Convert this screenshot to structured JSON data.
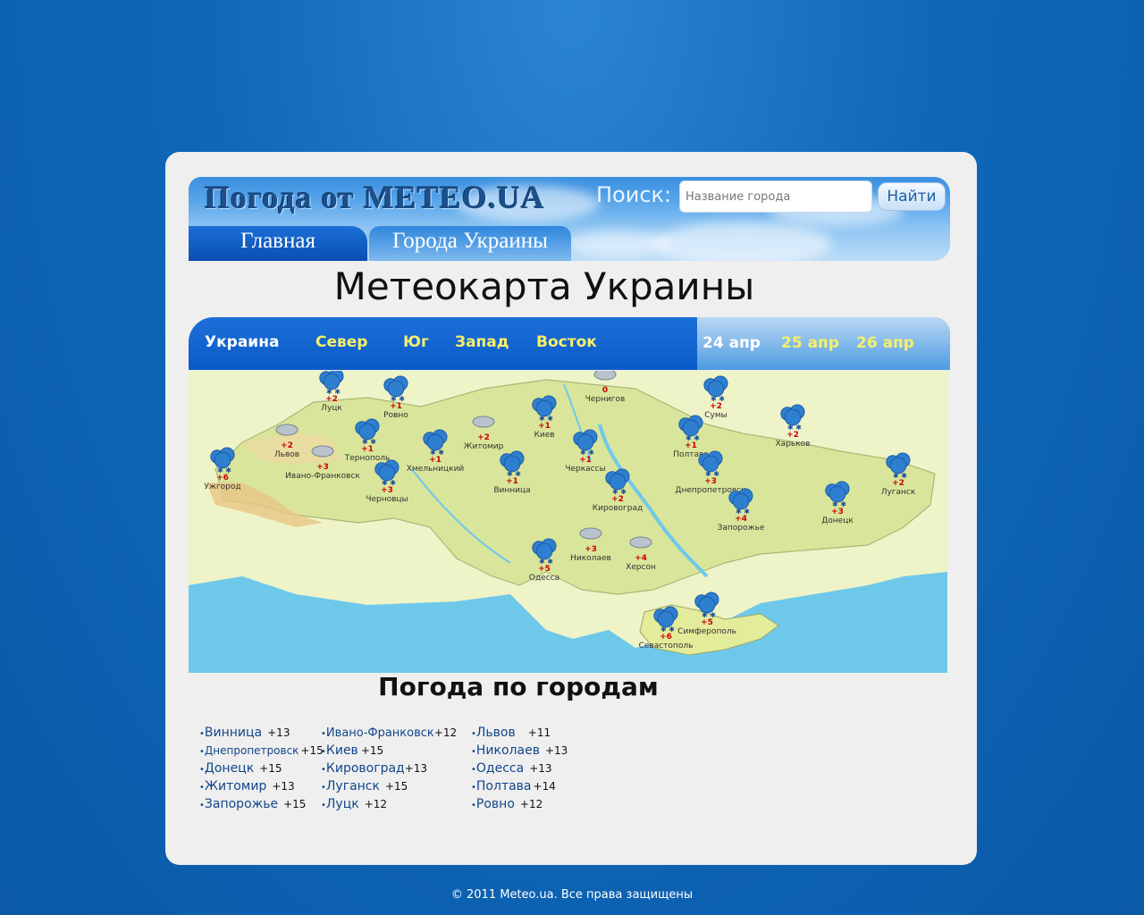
{
  "header": {
    "site_title": "Погода от METEO.UA",
    "search_label": "Поиск:",
    "search_placeholder": "Название города",
    "search_button": "Найти",
    "tabs": [
      {
        "label": "Главная"
      },
      {
        "label": "Города Украины"
      }
    ]
  },
  "page_title": "Метеокарта Украины",
  "region_tabs": [
    {
      "label": "Украина",
      "active": true
    },
    {
      "label": "Север"
    },
    {
      "label": "Юг"
    },
    {
      "label": "Запад"
    },
    {
      "label": "Восток"
    }
  ],
  "date_tabs": [
    {
      "label": "24 апр",
      "active": true
    },
    {
      "label": "25 апр"
    },
    {
      "label": "26 апр"
    }
  ],
  "map": {
    "cities": [
      {
        "name": "Чернигов",
        "temp": "0",
        "icon": "cloud-icon"
      },
      {
        "name": "Луцк",
        "temp": "+2",
        "icon": "rain-snow-icon"
      },
      {
        "name": "Ровно",
        "temp": "+1",
        "icon": "rain-snow-icon"
      },
      {
        "name": "Сумы",
        "temp": "+2",
        "icon": "rain-snow-icon"
      },
      {
        "name": "Львов",
        "temp": "+2",
        "icon": "cloud-icon"
      },
      {
        "name": "Тернополь",
        "temp": "+1",
        "icon": "rain-snow-icon"
      },
      {
        "name": "Житомир",
        "temp": "+2",
        "icon": "cloud-icon"
      },
      {
        "name": "Киев",
        "temp": "+1",
        "icon": "rain-snow-icon"
      },
      {
        "name": "Харьков",
        "temp": "+2",
        "icon": "rain-snow-icon"
      },
      {
        "name": "Хмельницкий",
        "temp": "+1",
        "icon": "rain-snow-icon"
      },
      {
        "name": "Полтава",
        "temp": "+1",
        "icon": "rain-snow-icon"
      },
      {
        "name": "Ивано-Франковск",
        "temp": "+3",
        "icon": "cloud-icon"
      },
      {
        "name": "Ужгород",
        "temp": "+6",
        "icon": "rain-snow-icon"
      },
      {
        "name": "Черкассы",
        "temp": "+1",
        "icon": "rain-snow-icon"
      },
      {
        "name": "Винница",
        "temp": "+1",
        "icon": "rain-snow-icon"
      },
      {
        "name": "Днепропетровск",
        "temp": "+3",
        "icon": "rain-snow-icon"
      },
      {
        "name": "Луганск",
        "temp": "+2",
        "icon": "rain-snow-icon"
      },
      {
        "name": "Черновцы",
        "temp": "+3",
        "icon": "rain-snow-icon"
      },
      {
        "name": "Кировоград",
        "temp": "+2",
        "icon": "rain-snow-icon"
      },
      {
        "name": "Донецк",
        "temp": "+3",
        "icon": "rain-snow-icon"
      },
      {
        "name": "Запорожье",
        "temp": "+4",
        "icon": "rain-snow-icon"
      },
      {
        "name": "Николаев",
        "temp": "+3",
        "icon": "cloud-icon"
      },
      {
        "name": "Херсон",
        "temp": "+4",
        "icon": "cloud-icon"
      },
      {
        "name": "Одесса",
        "temp": "+5",
        "icon": "rain-snow-icon"
      },
      {
        "name": "Симферополь",
        "temp": "+5",
        "icon": "rain-snow-icon"
      },
      {
        "name": "Севастополь",
        "temp": "+6",
        "icon": "rain-snow-icon"
      }
    ]
  },
  "cities_title": "Погода по городам",
  "cities_columns": [
    [
      {
        "name": "Винница",
        "temp": "+13"
      },
      {
        "name": "Днепропетровск",
        "temp": "+15"
      },
      {
        "name": "Донецк",
        "temp": "+15"
      },
      {
        "name": "Житомир",
        "temp": "+13"
      },
      {
        "name": "Запорожье",
        "temp": "+15"
      }
    ],
    [
      {
        "name": "Ивано-Франковск",
        "temp": "+12"
      },
      {
        "name": "Киев",
        "temp": "+15"
      },
      {
        "name": "Кировоград",
        "temp": "+13"
      },
      {
        "name": "Луганск",
        "temp": "+15"
      },
      {
        "name": "Луцк",
        "temp": "+12"
      }
    ],
    [
      {
        "name": "Львов",
        "temp": "+11"
      },
      {
        "name": "Николаев",
        "temp": "+13"
      },
      {
        "name": "Одесса",
        "temp": "+13"
      },
      {
        "name": "Полтава",
        "temp": "+14"
      },
      {
        "name": "Ровно",
        "temp": "+12"
      }
    ]
  ],
  "footer": "© 2011 Meteo.ua. Все права защищены",
  "colors": {
    "background": "#0f67b8",
    "tab_text_inactive": "#f6f06a",
    "link": "#12468a",
    "temp_on_map": "#cc0000"
  }
}
